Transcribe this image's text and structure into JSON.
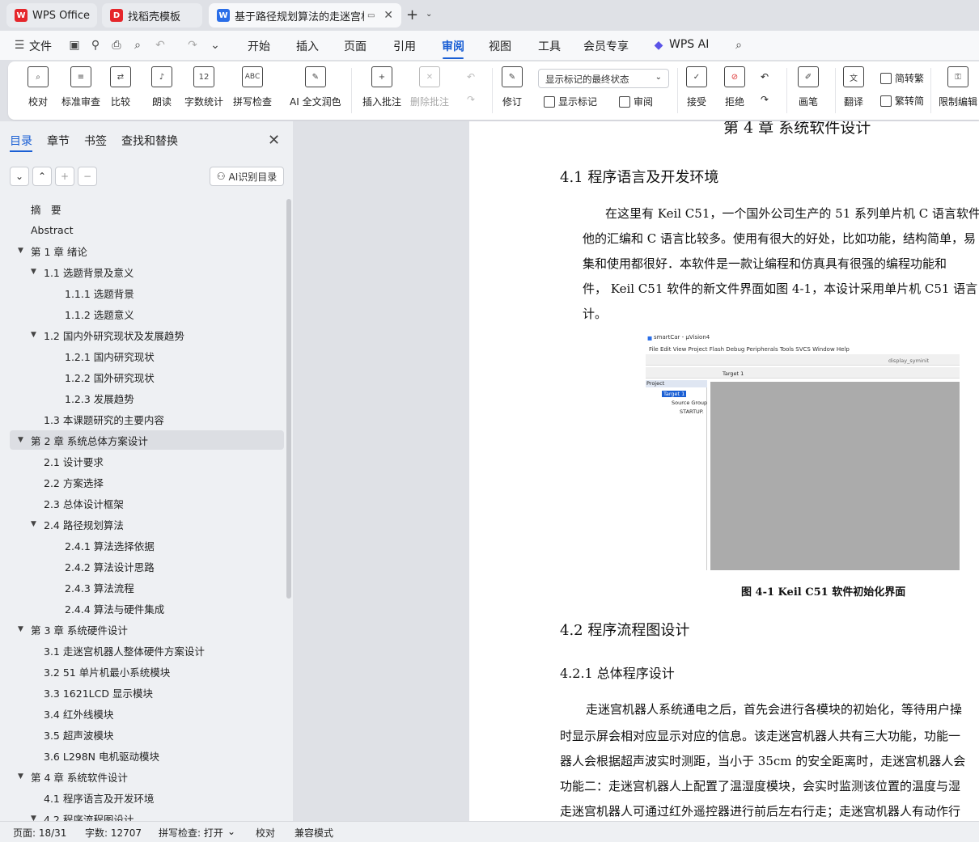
{
  "tabs": [
    {
      "label": "WPS Office",
      "icon": "wps-logo-icon"
    },
    {
      "label": "找稻壳模板",
      "icon": "docer-icon"
    },
    {
      "label": "基于路径规划算法的走迷宫机",
      "icon": "word-doc-icon"
    }
  ],
  "menu": [
    "文件",
    "开始",
    "插入",
    "页面",
    "引用",
    "审阅",
    "视图",
    "工具",
    "会员专享",
    "WPS AI"
  ],
  "ribbon": {
    "buttons": [
      "校对",
      "标准审查",
      "比较",
      "朗读",
      "字数统计",
      "拼写检查",
      "AI 全文润色",
      "插入批注",
      "删除批注",
      "修订",
      "画笔",
      "翻译",
      "限制编辑"
    ],
    "dropdown_value": "显示标记的最终状态",
    "small": [
      "显示标记",
      "审阅",
      "接受",
      "拒绝",
      "简转繁",
      "繁转简"
    ],
    "icon_text": {
      "word_count": "12",
      "spell": "ABC"
    }
  },
  "sidebar": {
    "tabs": [
      "目录",
      "章节",
      "书签",
      "查找和替换"
    ],
    "ai_button": "AI识别目录",
    "toc": [
      {
        "text": "摘　要",
        "level": 0,
        "arrow": ""
      },
      {
        "text": "Abstract",
        "level": 0,
        "arrow": ""
      },
      {
        "text": "第 1 章  绪论",
        "level": 0,
        "arrow": "▼"
      },
      {
        "text": "1.1  选题背景及意义",
        "level": 1,
        "arrow": "▼"
      },
      {
        "text": "1.1.1  选题背景",
        "level": 2,
        "arrow": ""
      },
      {
        "text": "1.1.2  选题意义",
        "level": 2,
        "arrow": ""
      },
      {
        "text": "1.2  国内外研究现状及发展趋势",
        "level": 1,
        "arrow": "▼"
      },
      {
        "text": "1.2.1  国内研究现状",
        "level": 2,
        "arrow": ""
      },
      {
        "text": "1.2.2  国外研究现状",
        "level": 2,
        "arrow": ""
      },
      {
        "text": "1.2.3  发展趋势",
        "level": 2,
        "arrow": ""
      },
      {
        "text": "1.3  本课题研究的主要内容",
        "level": 1,
        "arrow": ""
      },
      {
        "text": "第 2 章  系统总体方案设计",
        "level": 0,
        "arrow": "▼"
      },
      {
        "text": "2.1  设计要求",
        "level": 1,
        "arrow": ""
      },
      {
        "text": "2.2  方案选择",
        "level": 1,
        "arrow": ""
      },
      {
        "text": "2.3  总体设计框架",
        "level": 1,
        "arrow": ""
      },
      {
        "text": "2.4  路径规划算法",
        "level": 1,
        "arrow": "▼"
      },
      {
        "text": "2.4.1  算法选择依据",
        "level": 2,
        "arrow": ""
      },
      {
        "text": "2.4.2  算法设计思路",
        "level": 2,
        "arrow": ""
      },
      {
        "text": "2.4.3  算法流程",
        "level": 2,
        "arrow": ""
      },
      {
        "text": "2.4.4  算法与硬件集成",
        "level": 2,
        "arrow": ""
      },
      {
        "text": "第 3 章  系统硬件设计",
        "level": 0,
        "arrow": "▼"
      },
      {
        "text": "3.1  走迷宫机器人整体硬件方案设计",
        "level": 1,
        "arrow": ""
      },
      {
        "text": "3.2 51 单片机最小系统模块",
        "level": 1,
        "arrow": ""
      },
      {
        "text": "3.3 1621LCD 显示模块",
        "level": 1,
        "arrow": ""
      },
      {
        "text": "3.4  红外线模块",
        "level": 1,
        "arrow": ""
      },
      {
        "text": "3.5  超声波模块",
        "level": 1,
        "arrow": ""
      },
      {
        "text": "3.6 L298N 电机驱动模块",
        "level": 1,
        "arrow": ""
      },
      {
        "text": "第 4 章  系统软件设计",
        "level": 0,
        "arrow": "▼"
      },
      {
        "text": "4.1  程序语言及开发环境",
        "level": 1,
        "arrow": ""
      },
      {
        "text": "4.2  程序流程图设计",
        "level": 1,
        "arrow": "▼"
      }
    ]
  },
  "document": {
    "chapter_title": "第 4 章  系统软件设计",
    "h41": "4.1  程序语言及开发环境",
    "p1": [
      "在这里有 Keil C51，一个国外公司生产的 51 系列单片机 C 语言软件",
      "他的汇编和 C 语言比较多。使用有很大的好处，比如功能，结构简单，易",
      "集和使用都很好．本软件是一款让编程和仿真具有很强的编程功能和",
      "件，  Keil C51 软件的新文件界面如图 4-1，本设计采用单片机 C51 语言",
      "计。"
    ],
    "figure": {
      "window_title": "smartCar - µVision4",
      "menu": "File  Edit  View  Project  Flash  Debug  Peripherals  Tools  SVCS  Window  Help",
      "target_combo": "Target 1",
      "combo2": "display_syminit",
      "project_label": "Project",
      "tree": [
        "Target 1",
        "Source Group",
        "STARTUP."
      ]
    },
    "caption": "图 4-1 Keil C51 软件初始化界面",
    "h42": "4.2  程序流程图设计",
    "h421": "4.2.1  总体程序设计",
    "p2": [
      "走迷宫机器人系统通电之后，首先会进行各模块的初始化，等待用户操",
      "时显示屏会相对应显示对应的信息。该走迷宫机器人共有三大功能，功能一",
      "器人会根据超声波实时测距，当小于 35cm 的安全距离时，走迷宫机器人会",
      "功能二：走迷宫机器人上配置了温湿度模块，会实时监测该位置的温度与湿",
      "走迷宫机器人可通过红外遥控器进行前后左右行走；走迷宫机器人有动作行"
    ]
  },
  "status": {
    "page": "页面: 18/31",
    "words": "字数: 12707",
    "spell": "拼写检查: 打开",
    "proof": "校对",
    "compat": "兼容模式"
  },
  "colors": {
    "accent": "#1a5fd4",
    "wps_red": "#e5262b"
  }
}
